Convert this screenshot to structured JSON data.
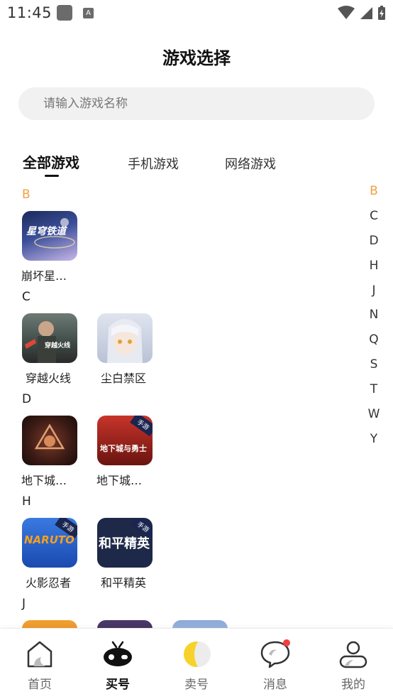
{
  "status_bar": {
    "time": "11:45",
    "badge_letter": "A"
  },
  "header": {
    "title": "游戏选择"
  },
  "search": {
    "placeholder": "请输入游戏名称"
  },
  "tabs": [
    {
      "label": "全部游戏",
      "active": true
    },
    {
      "label": "手机游戏",
      "active": false
    },
    {
      "label": "网络游戏",
      "active": false
    }
  ],
  "sections": [
    {
      "letter": "B",
      "highlight": true,
      "games": [
        {
          "name": "崩坏星…",
          "icon_text": "星穹铁道",
          "tag": ""
        }
      ]
    },
    {
      "letter": "C",
      "highlight": false,
      "games": [
        {
          "name": "穿越火线",
          "icon_text": "穿越火线",
          "tag": ""
        },
        {
          "name": "尘白禁区",
          "icon_text": "",
          "tag": ""
        }
      ]
    },
    {
      "letter": "D",
      "highlight": false,
      "games": [
        {
          "name": "地下城…",
          "icon_text": "",
          "tag": ""
        },
        {
          "name": "地下城…",
          "icon_text": "地下城与勇士",
          "tag": "手游"
        }
      ]
    },
    {
      "letter": "H",
      "highlight": false,
      "games": [
        {
          "name": "火影忍者",
          "icon_text": "NARUTO",
          "tag": "手游"
        },
        {
          "name": "和平精英",
          "icon_text": "和平精英",
          "tag": "手游"
        }
      ]
    },
    {
      "letter": "J",
      "highlight": false,
      "games": []
    }
  ],
  "alphabet_index": [
    "B",
    "C",
    "D",
    "H",
    "J",
    "N",
    "Q",
    "S",
    "T",
    "W",
    "Y"
  ],
  "alphabet_active": "B",
  "bottom_nav": [
    {
      "label": "首页",
      "icon": "home-icon",
      "active": false
    },
    {
      "label": "买号",
      "icon": "gamepad-icon",
      "active": true
    },
    {
      "label": "卖号",
      "icon": "sell-icon",
      "active": false
    },
    {
      "label": "消息",
      "icon": "message-icon",
      "active": false,
      "has_badge": true
    },
    {
      "label": "我的",
      "icon": "profile-icon",
      "active": false
    }
  ],
  "colors": {
    "accent": "#f0a040",
    "badge": "#f04040",
    "search_bg": "#f1f1f1"
  }
}
